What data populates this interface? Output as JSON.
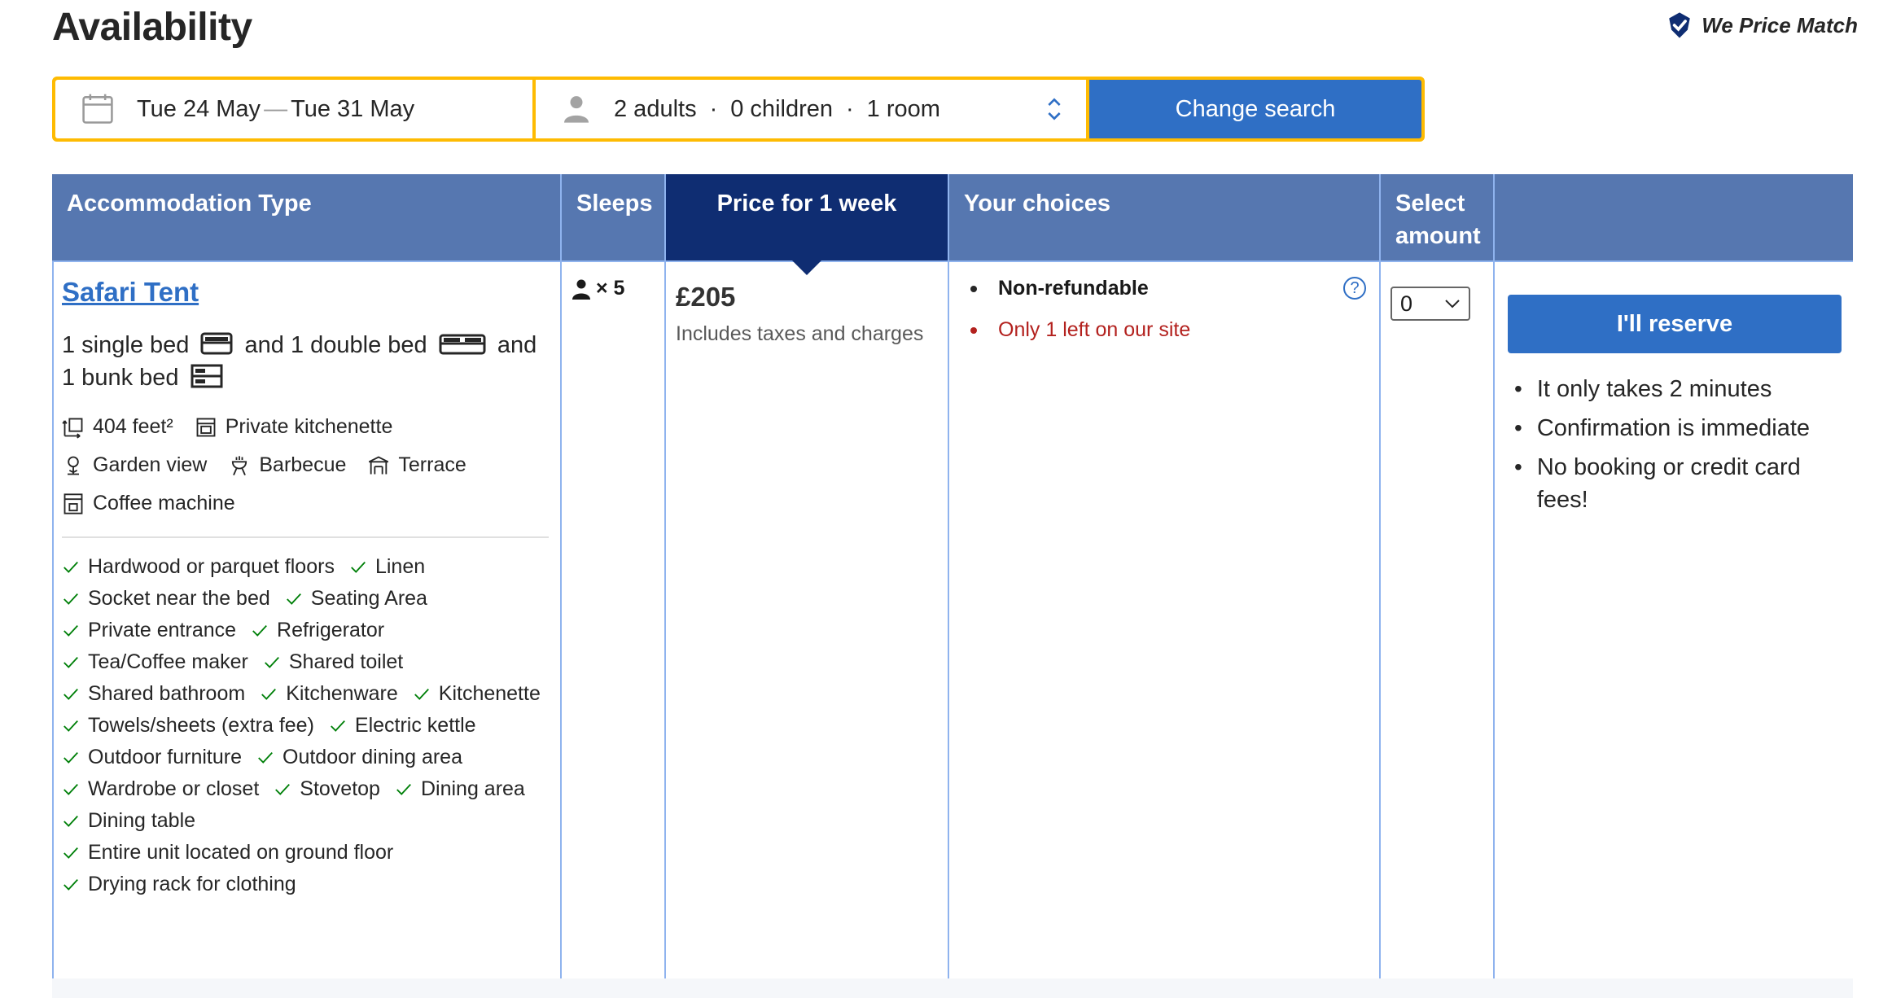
{
  "page": {
    "title": "Availability",
    "price_match": "We Price Match"
  },
  "search": {
    "date_from": "Tue 24 May",
    "date_sep": "—",
    "date_to": "Tue 31 May",
    "adults": "2 adults",
    "children": "0 children",
    "rooms": "1 room",
    "dot": "·",
    "button": "Change search"
  },
  "table": {
    "headers": [
      "Accommodation Type",
      "Sleeps",
      "Price for 1 week",
      "Your choices",
      "Select amount",
      ""
    ],
    "room": {
      "name": "Safari Tent",
      "beds": {
        "part1": "1 single bed",
        "and1": "and 1 double bed",
        "and2": "and",
        "part3": "1 bunk bed"
      },
      "facilities": [
        {
          "icon": "area-icon",
          "label": "404 feet²"
        },
        {
          "icon": "kitchenette-icon",
          "label": "Private kitchenette"
        },
        {
          "icon": "garden-icon",
          "label": "Garden view"
        },
        {
          "icon": "barbecue-icon",
          "label": "Barbecue"
        },
        {
          "icon": "terrace-icon",
          "label": "Terrace"
        },
        {
          "icon": "coffee-machine-icon",
          "label": "Coffee machine"
        }
      ],
      "amenities": [
        [
          "Hardwood or parquet floors",
          "Linen"
        ],
        [
          "Socket near the bed",
          "Seating Area"
        ],
        [
          "Private entrance",
          "Refrigerator"
        ],
        [
          "Tea/Coffee maker",
          "Shared toilet"
        ],
        [
          "Shared bathroom",
          "Kitchenware",
          "Kitchenette"
        ],
        [
          "Towels/sheets (extra fee)",
          "Electric kettle"
        ],
        [
          "Outdoor furniture",
          "Outdoor dining area"
        ],
        [
          "Wardrobe or closet",
          "Stovetop",
          "Dining area"
        ],
        [
          "Dining table"
        ],
        [
          "Entire unit located on ground floor"
        ],
        [
          "Drying rack for clothing"
        ]
      ],
      "sleeps": "× 5",
      "price": "£205",
      "price_note": "Includes taxes and charges",
      "choices": [
        "Non-refundable",
        "Only 1 left on our site"
      ],
      "select_value": "0",
      "reserve_button": "I'll reserve",
      "reserve_points": [
        "It only takes 2 minutes",
        "Confirmation is immediate",
        "No booking or credit card fees!"
      ]
    }
  },
  "colors": {
    "accent": "#2f6fc5",
    "header": "#5677b0",
    "header_active": "#0f2d72",
    "search_border": "#febb02",
    "warning": "#b3211e",
    "check": "#008009"
  }
}
